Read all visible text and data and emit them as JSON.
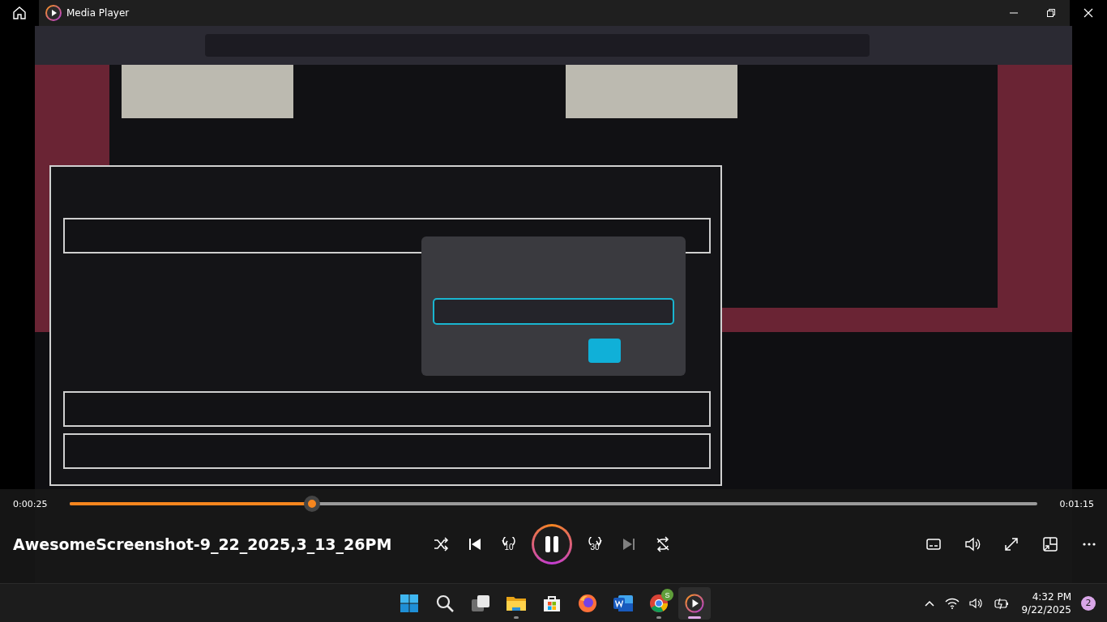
{
  "window": {
    "title": "Media Player"
  },
  "playback": {
    "elapsed": "0:00:25",
    "duration": "0:01:15",
    "level": 0.25,
    "title": "AwesomeScreenshot-9_22_2025,3_13_26PM",
    "playing": true
  },
  "controls": [
    {
      "kind": "shuffle",
      "disabled": false
    },
    {
      "kind": "previous",
      "disabled": false
    },
    {
      "kind": "rewind",
      "label": "10",
      "disabled": false
    },
    {
      "kind": "play_pause",
      "disabled": false
    },
    {
      "kind": "forward",
      "label": "30",
      "disabled": false
    },
    {
      "kind": "next",
      "disabled": true
    },
    {
      "kind": "repeat",
      "disabled": false
    }
  ],
  "tools": [
    {
      "kind": "subtitles"
    },
    {
      "kind": "volume"
    },
    {
      "kind": "fullscreen"
    },
    {
      "kind": "miniplayer"
    },
    {
      "kind": "more"
    }
  ],
  "taskbar": {
    "apps": [
      {
        "kind": "start",
        "running": false,
        "active": false
      },
      {
        "kind": "search",
        "running": false,
        "active": false
      },
      {
        "kind": "taskview",
        "running": false,
        "active": false
      },
      {
        "kind": "explorer",
        "running": true,
        "active": false
      },
      {
        "kind": "store",
        "running": false,
        "active": false
      },
      {
        "kind": "firefox",
        "running": false,
        "active": false
      },
      {
        "kind": "word",
        "running": false,
        "active": false
      },
      {
        "kind": "chrome",
        "running": true,
        "active": false,
        "badge": "S"
      },
      {
        "kind": "media",
        "running": true,
        "active": true
      }
    ],
    "time": "4:32 PM",
    "date": "9/22/2025",
    "notifications": "2"
  }
}
